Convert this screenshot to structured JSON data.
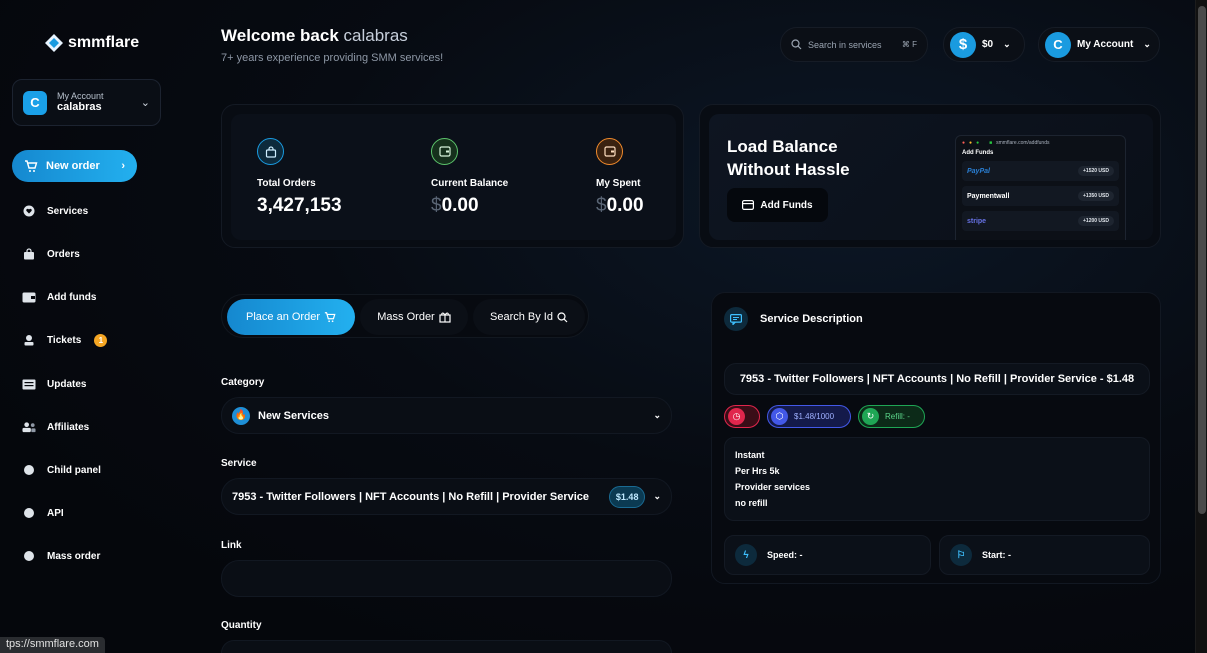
{
  "brand": {
    "name": "smmflare"
  },
  "sidebar": {
    "account_label": "My Account",
    "account_user": "calabras",
    "avatar_letter": "C",
    "new_order": "New order",
    "items": [
      {
        "label": "Services",
        "icon": "heart-icon"
      },
      {
        "label": "Orders",
        "icon": "bag-icon"
      },
      {
        "label": "Add funds",
        "icon": "wallet-icon"
      },
      {
        "label": "Tickets",
        "icon": "ticket-icon",
        "badge": "1"
      },
      {
        "label": "Updates",
        "icon": "newspaper-icon"
      },
      {
        "label": "Affiliates",
        "icon": "users-icon"
      },
      {
        "label": "Child panel",
        "icon": "dot-icon"
      },
      {
        "label": "API",
        "icon": "dot-icon"
      },
      {
        "label": "Mass order",
        "icon": "dot-icon"
      }
    ]
  },
  "header": {
    "welcome": "Welcome back",
    "username": "calabras",
    "subtitle": "7+ years experience providing SMM services!",
    "search_placeholder": "Search in services",
    "search_shortcut": "⌘ F",
    "balance": "$0",
    "account": "My Account",
    "avatar_letter": "C"
  },
  "stats": [
    {
      "label": "Total Orders",
      "currency": "",
      "value": "3,427,153",
      "color": "#1a9be0"
    },
    {
      "label": "Current Balance",
      "currency": "$",
      "value": "0.00",
      "color": "#5cc36b"
    },
    {
      "label": "My Spent",
      "currency": "$",
      "value": "0.00",
      "color": "#f08a2c"
    }
  ],
  "promo": {
    "title_line1": "Load Balance",
    "title_line2": "Without Hassle",
    "button": "Add Funds",
    "mock_url": "smmflare.com/addfunds",
    "mock_heading": "Add Funds",
    "methods": [
      {
        "name": "PayPal",
        "amount": "+1520 USD"
      },
      {
        "name": "Paymentwall",
        "amount": "+1350 USD"
      },
      {
        "name": "stripe",
        "amount": "+1200 USD"
      }
    ]
  },
  "tabs": [
    {
      "label": "Place an Order",
      "icon": "cart-icon",
      "active": true
    },
    {
      "label": "Mass Order",
      "icon": "gift-icon",
      "active": false
    },
    {
      "label": "Search By Id",
      "icon": "search-icon",
      "active": false
    }
  ],
  "form": {
    "category_label": "Category",
    "category_value": "New Services",
    "service_label": "Service",
    "service_value": "7953 -  Twitter Followers | NFT Accounts | No Refill | Provider Service",
    "service_price": "$1.48",
    "link_label": "Link",
    "link_value": "",
    "quantity_label": "Quantity"
  },
  "description": {
    "heading": "Service Description",
    "title": "7953 - Twitter Followers | NFT Accounts | No Refill | Provider Service - $1.48",
    "rate_chip": "$1.48/1000",
    "refill_chip": "Refill: -",
    "lines": [
      "Instant",
      "Per Hrs 5k",
      "Provider services",
      "no refill"
    ],
    "speed": "Speed: -",
    "start": "Start: -"
  },
  "status_bar": {
    "url": "tps://smmflare.com"
  }
}
